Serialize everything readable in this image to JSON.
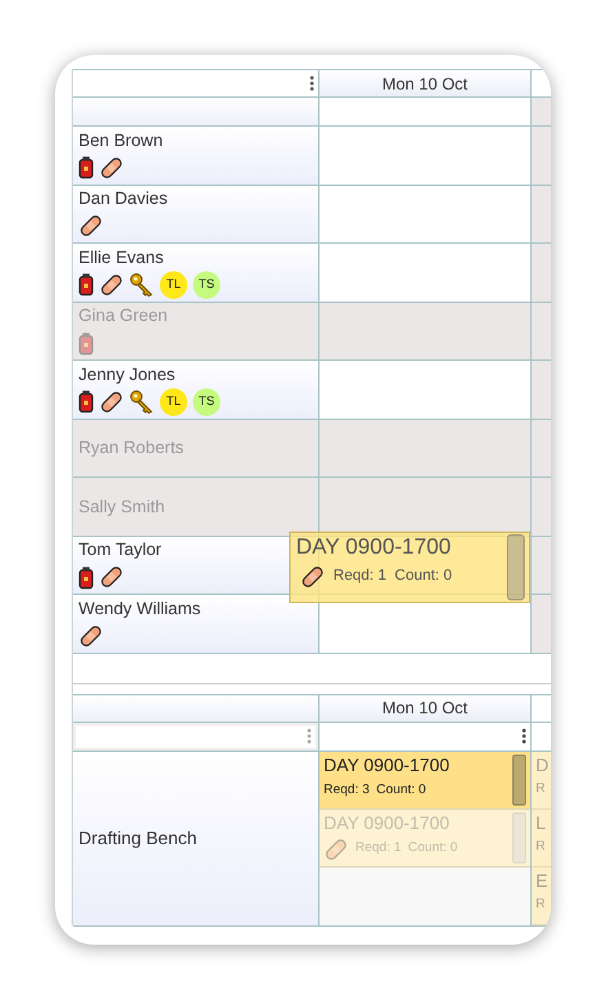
{
  "roster": {
    "date_header": "Mon 10 Oct",
    "staff": [
      {
        "name": "Ben Brown",
        "available": true,
        "badges": [
          {
            "kind": "extinguisher"
          },
          {
            "kind": "plaster"
          }
        ]
      },
      {
        "name": "Dan Davies",
        "available": true,
        "badges": [
          {
            "kind": "plaster"
          }
        ]
      },
      {
        "name": "Ellie Evans",
        "available": true,
        "badges": [
          {
            "kind": "extinguisher"
          },
          {
            "kind": "plaster"
          },
          {
            "kind": "key"
          },
          {
            "kind": "tag",
            "text": "TL",
            "color": "#ffe81a"
          },
          {
            "kind": "tag",
            "text": "TS",
            "color": "#c4fb7e"
          }
        ]
      },
      {
        "name": "Gina Green",
        "available": false,
        "badges": [
          {
            "kind": "extinguisher"
          }
        ]
      },
      {
        "name": "Jenny Jones",
        "available": true,
        "badges": [
          {
            "kind": "extinguisher"
          },
          {
            "kind": "plaster"
          },
          {
            "kind": "key"
          },
          {
            "kind": "tag",
            "text": "TL",
            "color": "#ffe81a"
          },
          {
            "kind": "tag",
            "text": "TS",
            "color": "#c4fb7e"
          }
        ]
      },
      {
        "name": "Ryan Roberts",
        "available": false
      },
      {
        "name": "Sally Smith",
        "available": false
      },
      {
        "name": "Tom Taylor",
        "available": true,
        "badges": [
          {
            "kind": "extinguisher"
          },
          {
            "kind": "plaster"
          }
        ]
      },
      {
        "name": "Wendy Williams",
        "available": true,
        "badges": [
          {
            "kind": "plaster"
          }
        ]
      }
    ],
    "drag_shift": {
      "title": "DAY 0900-1700",
      "badge": {
        "kind": "plaster"
      },
      "reqd": "Reqd: 1",
      "count": "Count: 0"
    }
  },
  "stations": {
    "date_header": "Mon 10 Oct",
    "rows": [
      {
        "name": "Drafting Bench",
        "shifts": [
          {
            "title": "DAY 0900-1700",
            "reqd": "Reqd: 3",
            "count": "Count: 0",
            "faded": false
          },
          {
            "title": "DAY 0900-1700",
            "reqd": "Reqd: 1",
            "count": "Count: 0",
            "faded": true,
            "badges": [
              {
                "kind": "plaster"
              }
            ]
          }
        ],
        "next_day_shifts": [
          {
            "title": "D",
            "reqd": "R"
          },
          {
            "title": "L",
            "reqd": "R"
          },
          {
            "title": "E",
            "reqd": "R"
          }
        ]
      }
    ]
  }
}
